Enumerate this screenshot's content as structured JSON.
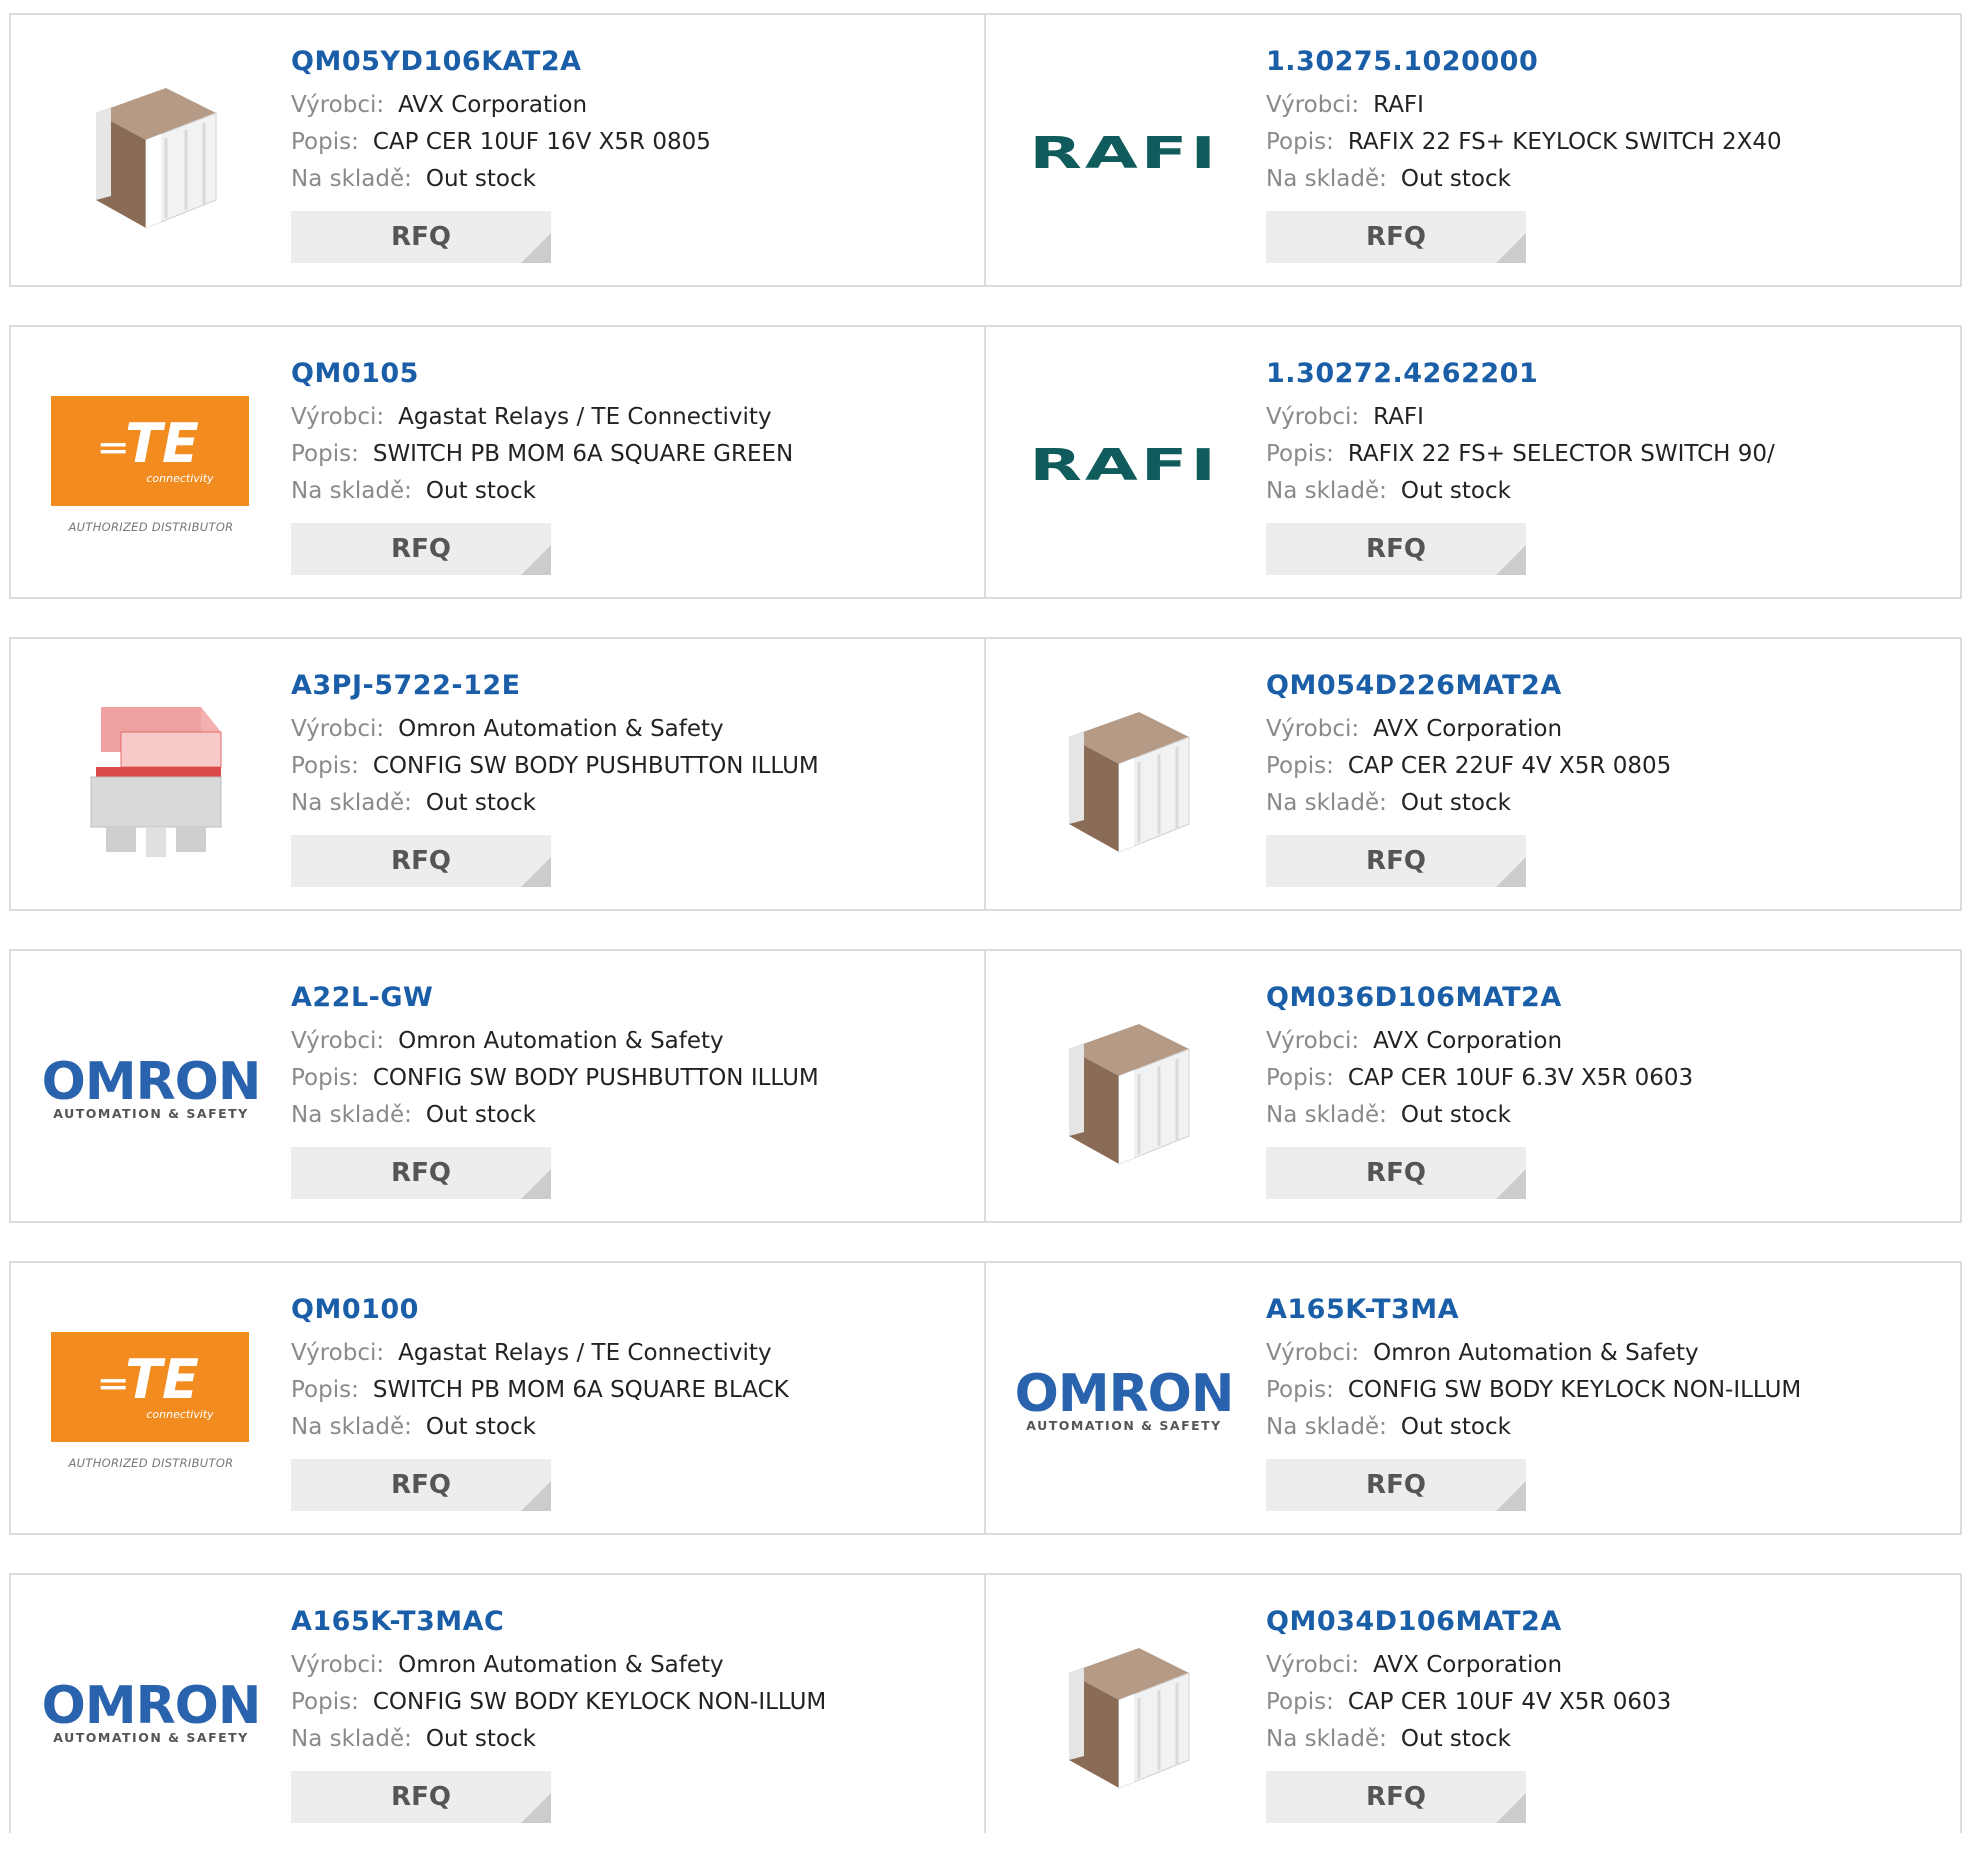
{
  "labels": {
    "manufacturer": "Výrobci:",
    "description": "Popis:",
    "stock": "Na skladě:",
    "rfq": "RFQ"
  },
  "logos": {
    "rafi": "RAFI",
    "omron_big": "OMRON",
    "omron_small": "AUTOMATION & SAFETY",
    "te": "TE",
    "te_sub": "connectivity",
    "te_dist": "AUTHORIZED DISTRIBUTOR"
  },
  "colors": {
    "part_link": "#1a5ea8",
    "rafi": "#105b5b",
    "omron": "#2a63ad",
    "te": "#f28c21"
  },
  "products": [
    {
      "part": "QM05YD106KAT2A",
      "manufacturer": "AVX Corporation",
      "description": "CAP CER 10UF 16V X5R 0805",
      "stock": "Out stock",
      "image": "capacitor-icon"
    },
    {
      "part": "1.30275.1020000",
      "manufacturer": "RAFI",
      "description": "RAFIX 22 FS+ KEYLOCK SWITCH 2X40",
      "stock": "Out stock",
      "image": "rafi-logo"
    },
    {
      "part": "QM0105",
      "manufacturer": "Agastat Relays / TE Connectivity",
      "description": "SWITCH PB MOM 6A SQUARE GREEN",
      "stock": "Out stock",
      "image": "te-logo"
    },
    {
      "part": "1.30272.4262201",
      "manufacturer": "RAFI",
      "description": "RAFIX 22 FS+ SELECTOR SWITCH 90/",
      "stock": "Out stock",
      "image": "rafi-logo"
    },
    {
      "part": "A3PJ-5722-12E",
      "manufacturer": "Omron Automation & Safety",
      "description": "CONFIG SW BODY PUSHBUTTON ILLUM",
      "stock": "Out stock",
      "image": "pushbutton-icon"
    },
    {
      "part": "QM054D226MAT2A",
      "manufacturer": "AVX Corporation",
      "description": "CAP CER 22UF 4V X5R 0805",
      "stock": "Out stock",
      "image": "capacitor-icon"
    },
    {
      "part": "A22L-GW",
      "manufacturer": "Omron Automation & Safety",
      "description": "CONFIG SW BODY PUSHBUTTON ILLUM",
      "stock": "Out stock",
      "image": "omron-logo"
    },
    {
      "part": "QM036D106MAT2A",
      "manufacturer": "AVX Corporation",
      "description": "CAP CER 10UF 6.3V X5R 0603",
      "stock": "Out stock",
      "image": "capacitor-icon"
    },
    {
      "part": "QM0100",
      "manufacturer": "Agastat Relays / TE Connectivity",
      "description": "SWITCH PB MOM 6A SQUARE BLACK",
      "stock": "Out stock",
      "image": "te-logo"
    },
    {
      "part": "A165K-T3MA",
      "manufacturer": "Omron Automation & Safety",
      "description": "CONFIG SW BODY KEYLOCK NON-ILLUM",
      "stock": "Out stock",
      "image": "omron-logo"
    },
    {
      "part": "A165K-T3MAC",
      "manufacturer": "Omron Automation & Safety",
      "description": "CONFIG SW BODY KEYLOCK NON-ILLUM",
      "stock": "Out stock",
      "image": "omron-logo"
    },
    {
      "part": "QM034D106MAT2A",
      "manufacturer": "AVX Corporation",
      "description": "CAP CER 10UF 4V X5R 0603",
      "stock": "Out stock",
      "image": "capacitor-icon"
    }
  ]
}
